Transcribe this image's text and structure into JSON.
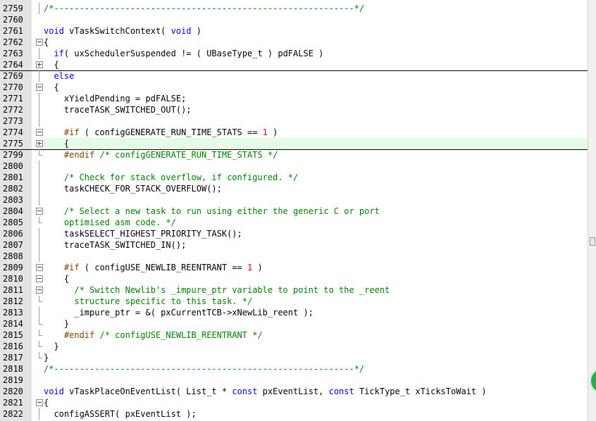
{
  "editor": {
    "lines": [
      {
        "num": "2759",
        "fold": "line",
        "tokens": [
          {
            "t": "cm",
            "v": "/*-----------------------------------------------------------*/"
          }
        ]
      },
      {
        "num": "2760",
        "fold": "",
        "tokens": []
      },
      {
        "num": "2761",
        "fold": "",
        "tokens": [
          {
            "t": "kw",
            "v": "void"
          },
          {
            "t": "id",
            "v": " vTaskSwitchContext( "
          },
          {
            "t": "kw",
            "v": "void"
          },
          {
            "t": "id",
            "v": " )"
          }
        ]
      },
      {
        "num": "2762",
        "fold": "minus",
        "tokens": [
          {
            "t": "id",
            "v": "{"
          }
        ]
      },
      {
        "num": "2763",
        "fold": "line",
        "tokens": [
          {
            "t": "id",
            "v": "  "
          },
          {
            "t": "kw",
            "v": "if"
          },
          {
            "t": "id",
            "v": "( uxSchedulerSuspended != ( UBaseType_t ) pdFALSE )"
          }
        ]
      },
      {
        "num": "2764",
        "fold": "plus",
        "sep": true,
        "tokens": [
          {
            "t": "id",
            "v": "  {"
          }
        ]
      },
      {
        "num": "2769",
        "fold": "line",
        "tokens": [
          {
            "t": "id",
            "v": "  "
          },
          {
            "t": "kw",
            "v": "else"
          }
        ]
      },
      {
        "num": "2770",
        "fold": "minus",
        "tokens": [
          {
            "t": "id",
            "v": "  {"
          }
        ]
      },
      {
        "num": "2771",
        "fold": "line",
        "tokens": [
          {
            "t": "id",
            "v": "    xYieldPending = pdFALSE;"
          }
        ]
      },
      {
        "num": "2772",
        "fold": "line",
        "tokens": [
          {
            "t": "id",
            "v": "    traceTASK_SWITCHED_OUT();"
          }
        ]
      },
      {
        "num": "2773",
        "fold": "line",
        "tokens": []
      },
      {
        "num": "2774",
        "fold": "minus",
        "tokens": [
          {
            "t": "pp",
            "v": "    #if"
          },
          {
            "t": "id",
            "v": " ( configGENERATE_RUN_TIME_STATS == "
          },
          {
            "t": "num",
            "v": "1"
          },
          {
            "t": "id",
            "v": " )"
          }
        ]
      },
      {
        "num": "2775",
        "fold": "plus",
        "hl": true,
        "tokens": [
          {
            "t": "id",
            "v": "    {"
          }
        ]
      },
      {
        "num": "2799",
        "fold": "end",
        "tokens": [
          {
            "t": "pp",
            "v": "    #endif"
          },
          {
            "t": "cm",
            "v": " /* configGENERATE_RUN_TIME_STATS */"
          }
        ]
      },
      {
        "num": "2800",
        "fold": "line",
        "tokens": []
      },
      {
        "num": "2801",
        "fold": "line",
        "tokens": [
          {
            "t": "cm",
            "v": "    /* Check for stack overflow, if configured. */"
          }
        ]
      },
      {
        "num": "2802",
        "fold": "line",
        "tokens": [
          {
            "t": "id",
            "v": "    taskCHECK_FOR_STACK_OVERFLOW();"
          }
        ]
      },
      {
        "num": "2803",
        "fold": "line",
        "tokens": []
      },
      {
        "num": "2804",
        "fold": "minus",
        "tokens": [
          {
            "t": "cm",
            "v": "    /* Select a new task to run using either the generic C or port"
          }
        ]
      },
      {
        "num": "2805",
        "fold": "end",
        "tokens": [
          {
            "t": "cm",
            "v": "    optimised asm code. */"
          }
        ]
      },
      {
        "num": "2806",
        "fold": "line",
        "tokens": [
          {
            "t": "id",
            "v": "    taskSELECT_HIGHEST_PRIORITY_TASK();"
          }
        ]
      },
      {
        "num": "2807",
        "fold": "line",
        "tokens": [
          {
            "t": "id",
            "v": "    traceTASK_SWITCHED_IN();"
          }
        ]
      },
      {
        "num": "2808",
        "fold": "line",
        "tokens": []
      },
      {
        "num": "2809",
        "fold": "minus",
        "tokens": [
          {
            "t": "pp",
            "v": "    #if"
          },
          {
            "t": "id",
            "v": " ( configUSE_NEWLIB_REENTRANT == "
          },
          {
            "t": "num",
            "v": "1"
          },
          {
            "t": "id",
            "v": " )"
          }
        ]
      },
      {
        "num": "2810",
        "fold": "minus",
        "tokens": [
          {
            "t": "id",
            "v": "    {"
          }
        ]
      },
      {
        "num": "2811",
        "fold": "minus",
        "tokens": [
          {
            "t": "cm",
            "v": "      /* Switch Newlib's _impure_ptr variable to point to the _reent"
          }
        ]
      },
      {
        "num": "2812",
        "fold": "end",
        "tokens": [
          {
            "t": "cm",
            "v": "      structure specific to this task. */"
          }
        ]
      },
      {
        "num": "2813",
        "fold": "line",
        "tokens": [
          {
            "t": "id",
            "v": "      _impure_ptr = &( pxCurrentTCB->xNewLib_reent );"
          }
        ]
      },
      {
        "num": "2814",
        "fold": "end",
        "tokens": [
          {
            "t": "id",
            "v": "    }"
          }
        ]
      },
      {
        "num": "2815",
        "fold": "end",
        "tokens": [
          {
            "t": "pp",
            "v": "    #endif"
          },
          {
            "t": "cm",
            "v": " /* configUSE_NEWLIB_REENTRANT */"
          }
        ]
      },
      {
        "num": "2816",
        "fold": "end",
        "tokens": [
          {
            "t": "id",
            "v": "  }"
          }
        ]
      },
      {
        "num": "2817",
        "fold": "end",
        "tokens": [
          {
            "t": "id",
            "v": "}"
          }
        ]
      },
      {
        "num": "2818",
        "fold": "",
        "tokens": [
          {
            "t": "cm",
            "v": "/*-----------------------------------------------------------*/"
          }
        ]
      },
      {
        "num": "2819",
        "fold": "",
        "tokens": []
      },
      {
        "num": "2820",
        "fold": "",
        "tokens": [
          {
            "t": "kw",
            "v": "void"
          },
          {
            "t": "id",
            "v": " vTaskPlaceOnEventList( List_t * "
          },
          {
            "t": "kw",
            "v": "const"
          },
          {
            "t": "id",
            "v": " pxEventList, "
          },
          {
            "t": "kw",
            "v": "const"
          },
          {
            "t": "id",
            "v": " TickType_t xTicksToWait )"
          }
        ]
      },
      {
        "num": "2821",
        "fold": "minus",
        "tokens": [
          {
            "t": "id",
            "v": "{"
          }
        ]
      },
      {
        "num": "2822",
        "fold": "line",
        "tokens": [
          {
            "t": "id",
            "v": "  configASSERT( pxEventList );"
          }
        ]
      }
    ]
  },
  "colors": {
    "keyword": "#0000ff",
    "comment": "#008000",
    "preprocessor": "#804000",
    "number": "#ff0000",
    "highlight_line": "#e5fbe5",
    "gutter": "#e4e4e4"
  }
}
